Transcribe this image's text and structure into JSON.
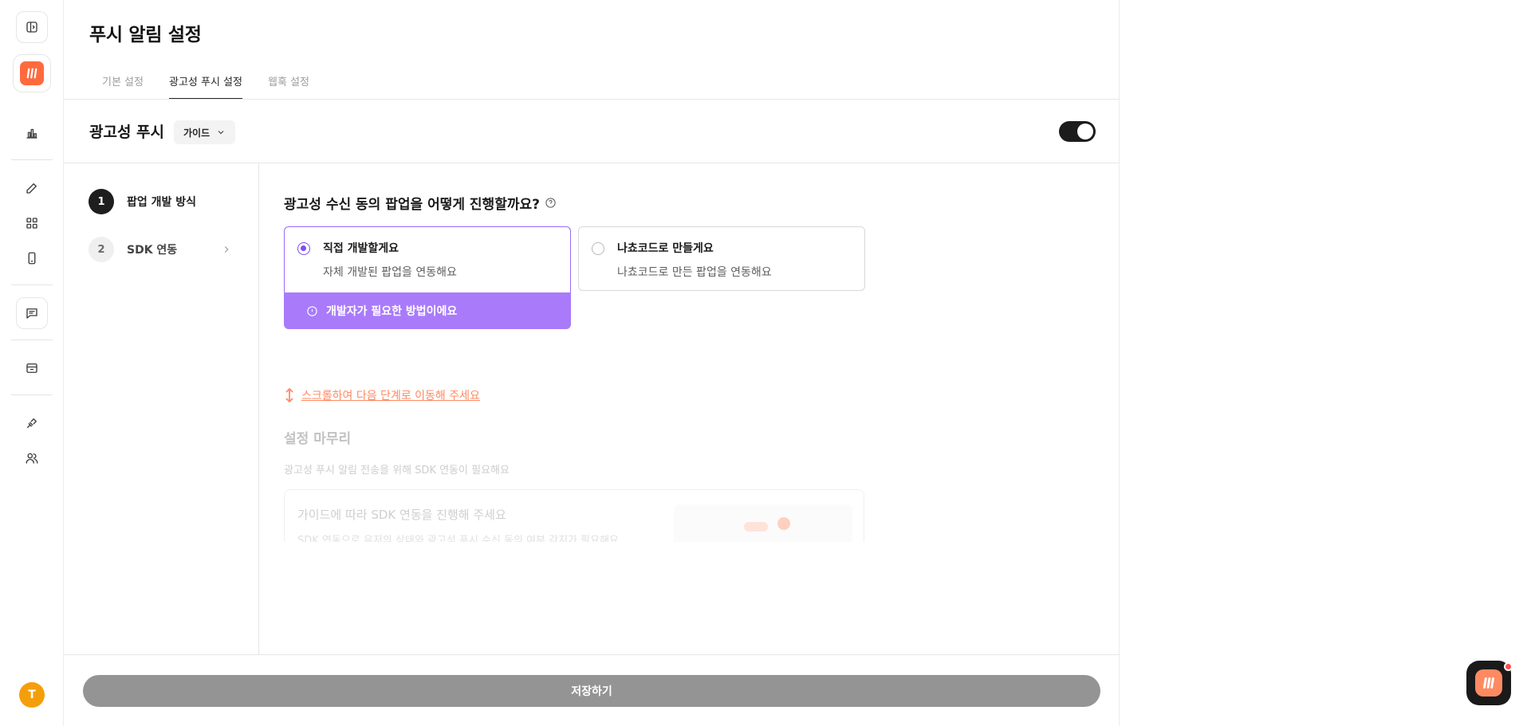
{
  "header": {
    "title": "푸시 알림 설정",
    "tabs": [
      {
        "label": "기본 설정"
      },
      {
        "label": "광고성 푸시 설정"
      },
      {
        "label": "웹훅 설정"
      }
    ],
    "active_tab": "광고성 푸시 설정"
  },
  "section": {
    "title": "광고성 푸시",
    "guide_label": "가이드",
    "toggle_on": true
  },
  "steps": [
    {
      "number": "1",
      "label": "팝업 개발 방식"
    },
    {
      "number": "2",
      "label": "SDK 연동"
    }
  ],
  "question": {
    "text": "광고성 수신 동의 팝업을 어떻게 진행할까요?",
    "options": [
      {
        "title": "직접 개발할게요",
        "subtitle": "자체 개발된 팝업을 연동해요",
        "selected": true,
        "note": "개발자가 필요한 방법이에요"
      },
      {
        "title": "나쵸코드로 만들게요",
        "subtitle": "나쵸코드로 만든 팝업을 연동해요",
        "selected": false
      }
    ]
  },
  "scroll_hint": "스크롤하여 다음 단계로 이동해 주세요",
  "next_section": {
    "title": "설정 마무리",
    "subtitle": "광고성 푸시 알림 전송을 위해 SDK 연동이 필요해요",
    "card_title": "가이드에 따라 SDK 연동을 진행해 주세요",
    "card_sub": "SDK 연동으로 유저의 상태와 광고성 푸시 수신 동의 여부 감지가 필요해요"
  },
  "footer": {
    "save_label": "저장하기"
  },
  "user": {
    "avatar_initial": "T"
  },
  "colors": {
    "accent": "#9a6bf5",
    "brand": "#ff6a3d",
    "hint": "#ff8a62"
  }
}
